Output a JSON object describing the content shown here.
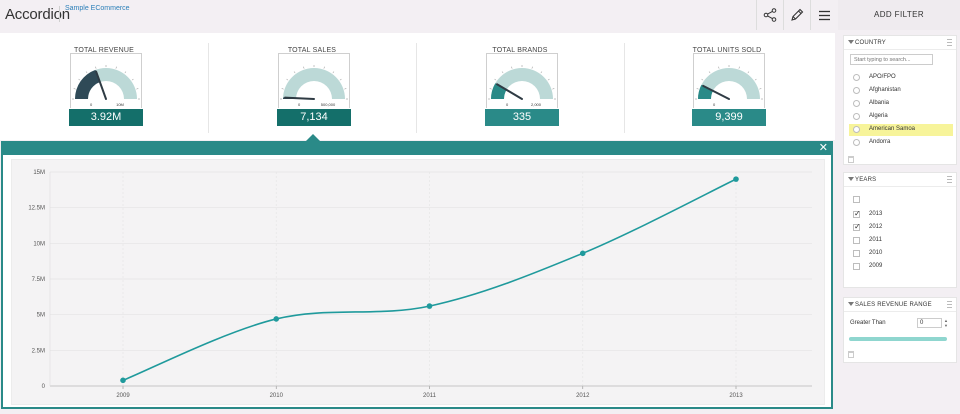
{
  "header": {
    "title": "Accordion",
    "subtitle": "Sample ECommerce",
    "icons": [
      "share-icon",
      "pencil-icon",
      "hamburger-icon"
    ]
  },
  "kpis": [
    {
      "label": "TOTAL REVENUE",
      "value": "3.92M",
      "gauge_min": "0",
      "gauge_max": "10M",
      "level": 0.39,
      "style": "dark"
    },
    {
      "label": "TOTAL SALES",
      "value": "7,134",
      "gauge_min": "0",
      "gauge_max": "500,000",
      "level": 0.015,
      "style": "dark"
    },
    {
      "label": "TOTAL BRANDS",
      "value": "335",
      "gauge_min": "0",
      "gauge_max": "2,000",
      "level": 0.17,
      "style": "light"
    },
    {
      "label": "TOTAL UNITS SOLD",
      "value": "9,399",
      "gauge_min": "0",
      "gauge_max": "",
      "level": 0.15,
      "style": "light"
    }
  ],
  "colors": {
    "teal": "#2a8a88",
    "teal_dark": "#146f6a",
    "gauge_fill": "#bcd9d7",
    "highlight": "#f7f49a",
    "range": "#8fd6cf"
  },
  "filters": {
    "title": "ADD FILTER",
    "country": {
      "title": "COUNTRY",
      "placeholder": "Start typing to search...",
      "options": [
        {
          "label": "APO/FPO",
          "highlighted": false
        },
        {
          "label": "Afghanistan",
          "highlighted": false
        },
        {
          "label": "Albania",
          "highlighted": false
        },
        {
          "label": "Algeria",
          "highlighted": false
        },
        {
          "label": "American Samoa",
          "highlighted": true
        },
        {
          "label": "Andorra",
          "highlighted": false
        }
      ]
    },
    "years": {
      "title": "YEARS",
      "options": [
        {
          "label": "2013",
          "checked": true
        },
        {
          "label": "2012",
          "checked": true
        },
        {
          "label": "2011",
          "checked": false
        },
        {
          "label": "2010",
          "checked": false
        },
        {
          "label": "2009",
          "checked": false
        }
      ]
    },
    "revenue_range": {
      "title": "SALES REVENUE RANGE",
      "label": "Greater Than",
      "value": "0"
    }
  },
  "chart_data": {
    "type": "line",
    "title": "",
    "xlabel": "",
    "ylabel": "",
    "categories": [
      "2009",
      "2010",
      "2011",
      "2012",
      "2013"
    ],
    "series": [
      {
        "values": [
          400000,
          4700000,
          5600000,
          9300000,
          14500000
        ]
      }
    ],
    "ylim": [
      0,
      15000000
    ],
    "yticks": [
      0,
      2500000,
      5000000,
      7500000,
      10000000,
      12500000,
      15000000
    ],
    "ytick_labels": [
      "0",
      "2.5M",
      "5M",
      "7.5M",
      "10M",
      "12.5M",
      "15M"
    ],
    "grid": true,
    "line_color": "#1f9a9c"
  }
}
